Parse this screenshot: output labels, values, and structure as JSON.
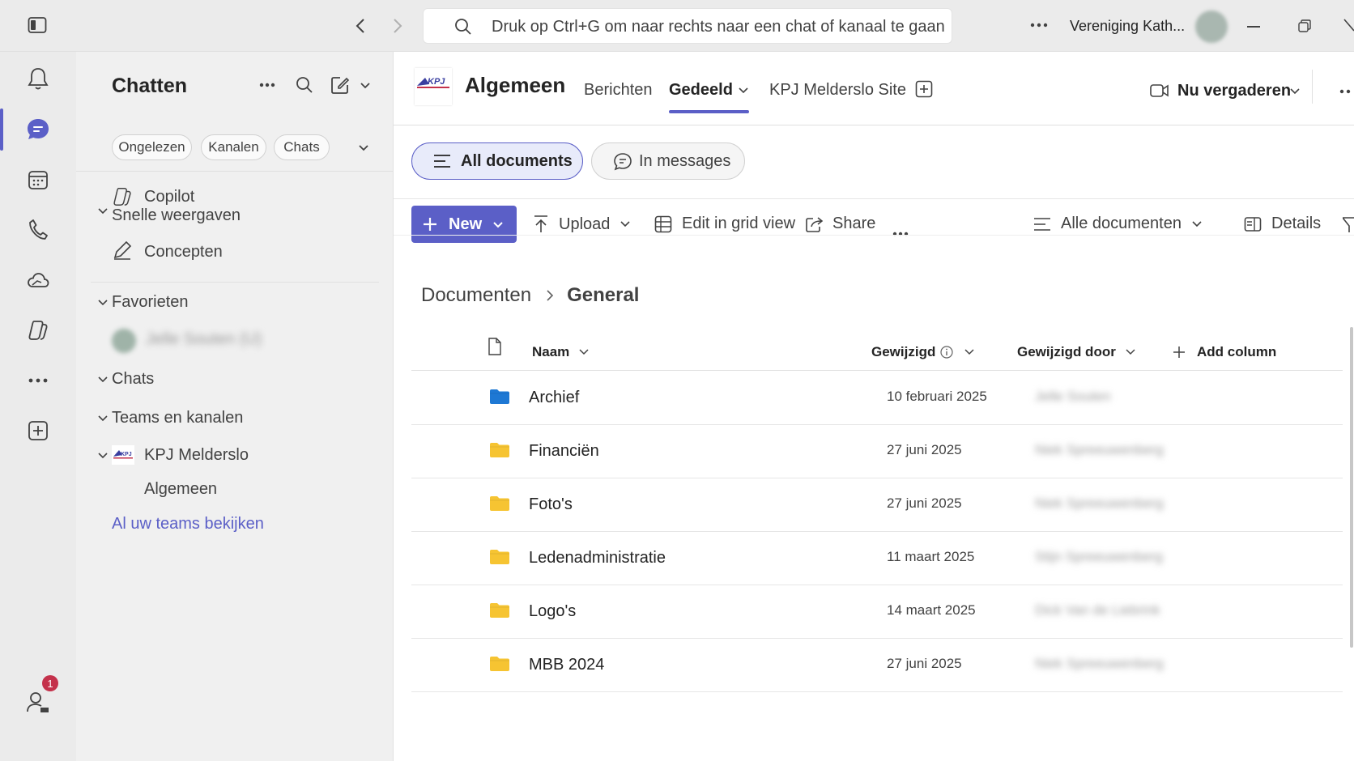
{
  "topbar": {
    "search_placeholder": "Druk op Ctrl+G om naar rechts naar een chat of kanaal te gaan",
    "org_name": "Vereniging Kath..."
  },
  "rail": {
    "items": [
      {
        "icon": "bell-icon"
      },
      {
        "icon": "chat-icon",
        "active": true
      },
      {
        "icon": "calendar-icon"
      },
      {
        "icon": "phone-icon"
      },
      {
        "icon": "cloud-icon"
      },
      {
        "icon": "copilot-icon"
      },
      {
        "icon": "more-icon"
      },
      {
        "icon": "add-app-icon"
      }
    ],
    "notification_badge": "1"
  },
  "chatpane": {
    "title": "Chatten",
    "filters": [
      "Ongelezen",
      "Kanalen",
      "Chats"
    ],
    "copilot": "Copilot",
    "quick_views": "Snelle weergaven",
    "drafts": "Concepten",
    "favorites": "Favorieten",
    "favorite_contact": "Jelle Souten (U)",
    "chats": "Chats",
    "teams_channels": "Teams en kanalen",
    "team_name": "KPJ Melderslo",
    "channel_name": "Algemeen",
    "view_all_teams": "Al uw teams bekijken"
  },
  "channel": {
    "title": "Algemeen",
    "tabs": [
      "Berichten",
      "Gedeeld",
      "KPJ Melderslo Site"
    ],
    "active_tab": "Gedeeld",
    "meet_now": "Nu vergaderen"
  },
  "documents": {
    "view_toggle": [
      "All documents",
      "In messages"
    ],
    "commands": {
      "new": "New",
      "upload": "Upload",
      "edit_grid": "Edit in grid view",
      "share": "Share",
      "view_name": "Alle documenten",
      "details": "Details"
    },
    "breadcrumb": [
      "Documenten",
      "General"
    ],
    "columns": {
      "name": "Naam",
      "modified": "Gewijzigd",
      "modified_by": "Gewijzigd door",
      "add_column": "Add column"
    },
    "rows": [
      {
        "name": "Archief",
        "modified": "10 februari 2025",
        "modified_by": "Jelle Souten",
        "folder_color": "#1e78d4"
      },
      {
        "name": "Financiën",
        "modified": "27 juni 2025",
        "modified_by": "Niek Spreeuwenberg",
        "folder_color": "#f6c432"
      },
      {
        "name": "Foto's",
        "modified": "27 juni 2025",
        "modified_by": "Niek Spreeuwenberg",
        "folder_color": "#f6c432"
      },
      {
        "name": "Ledenadministratie",
        "modified": "11 maart 2025",
        "modified_by": "Stijn Spreeuwenberg",
        "folder_color": "#f6c432"
      },
      {
        "name": "Logo's",
        "modified": "14 maart 2025",
        "modified_by": "Dick Van de Liebrink",
        "folder_color": "#f6c432"
      },
      {
        "name": "MBB 2024",
        "modified": "27 juni 2025",
        "modified_by": "Niek Spreeuwenberg",
        "folder_color": "#f6c432"
      }
    ]
  },
  "colors": {
    "accent": "#5b5fc7",
    "badge": "#c4314b"
  }
}
